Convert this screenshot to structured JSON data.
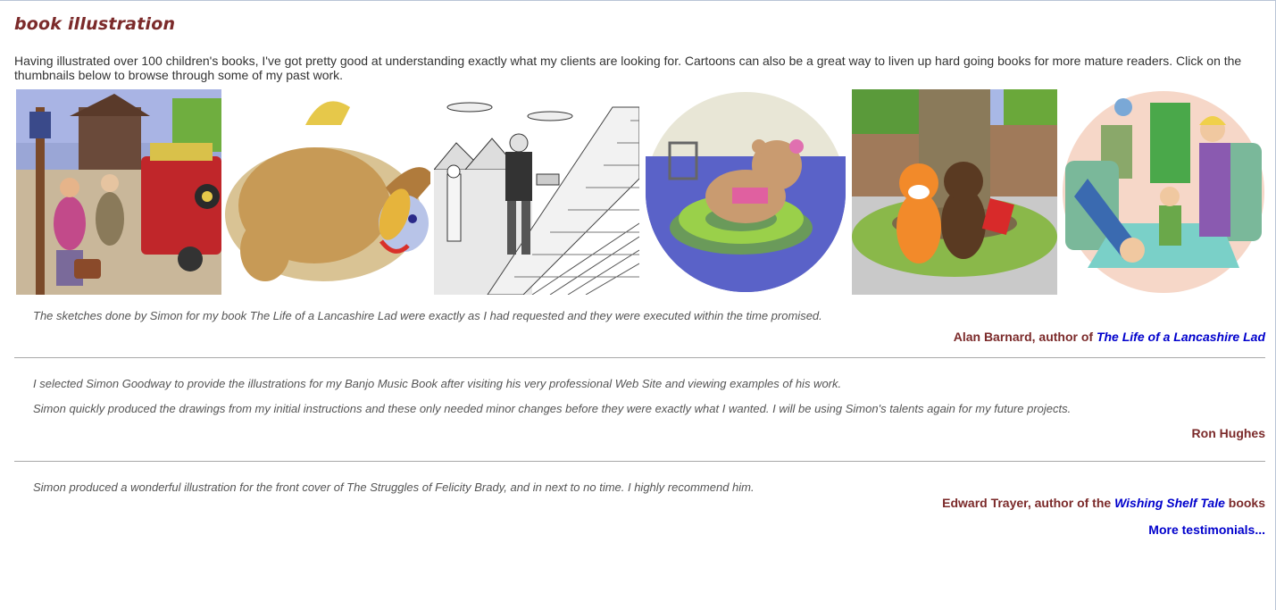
{
  "page": {
    "title": "book illustration",
    "intro": "Having illustrated over 100 children's books, I've got pretty good at understanding exactly what my clients are looking for. Cartoons can also be a great way to liven up hard going books for more mature readers. Click on the thumbnails below to browse through some of my past work."
  },
  "thumbnails": [
    {
      "name": "thumbnail-railway-station"
    },
    {
      "name": "thumbnail-falling-bear"
    },
    {
      "name": "thumbnail-pyramid-stairs"
    },
    {
      "name": "thumbnail-bear-pool"
    },
    {
      "name": "thumbnail-tiger-bear-tree"
    },
    {
      "name": "thumbnail-family-room"
    }
  ],
  "testimonials": [
    {
      "quote_lines": [
        "The sketches done by Simon for my book The Life of a Lancashire Lad were exactly as I had requested and they were executed within the time promised."
      ],
      "author_prefix": "Alan Barnard, author of ",
      "author_link": "The Life of a Lancashire Lad",
      "author_suffix": ""
    },
    {
      "quote_lines": [
        "I selected Simon Goodway to provide the illustrations for my Banjo Music Book after visiting his very professional Web Site and viewing examples of his work.",
        "Simon quickly produced the drawings from my initial instructions and these only needed minor changes before they were exactly what I wanted. I will be using Simon's talents again for my future projects."
      ],
      "author_prefix": "Ron Hughes",
      "author_link": "",
      "author_suffix": ""
    },
    {
      "quote_lines": [
        "Simon produced a wonderful illustration for the front cover of The Struggles of Felicity Brady, and in next to no time. I highly recommend him."
      ],
      "author_prefix": "Edward Trayer, author of the ",
      "author_link": "Wishing Shelf Tale",
      "author_suffix": " books"
    }
  ],
  "more_link": "More testimonials...",
  "colors": {
    "heading": "#7b2a2a",
    "link": "#0000cc",
    "rule": "#a8a8a8"
  }
}
